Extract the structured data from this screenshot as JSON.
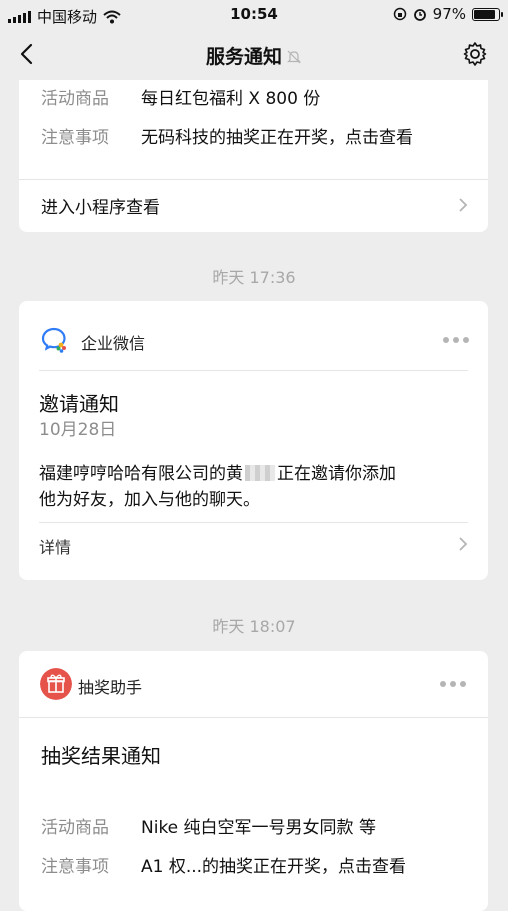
{
  "status_bar": {
    "carrier": "中国移动",
    "time": "10:54",
    "battery": "97%",
    "battery_level": 0.97
  },
  "nav": {
    "title": "服务通知"
  },
  "card1": {
    "rows": [
      {
        "key": "活动商品",
        "value": "每日红包福利 X 800 份"
      },
      {
        "key": "注意事项",
        "value": "无码科技的抽奖正在开奖，点击查看"
      }
    ],
    "link": "进入小程序查看"
  },
  "time1": "昨天 17:36",
  "card2": {
    "app_name": "企业微信",
    "title": "邀请通知",
    "date": "10月28日",
    "body_line1_a": "福建哼哼哈哈有限公司的黄",
    "body_line1_b": "正在邀请你添加",
    "body_line2": "他为好友，加入与他的聊天。",
    "detail": "详情"
  },
  "time2": "昨天 18:07",
  "card3": {
    "app_name": "抽奖助手",
    "title": "抽奖结果通知",
    "rows": [
      {
        "key": "活动商品",
        "value": "Nike  纯白空军一号男女同款 等"
      },
      {
        "key": "注意事项",
        "value": "A1  权...的抽奖正在开奖，点击查看"
      }
    ]
  },
  "colors": {
    "background": "#ededed",
    "card": "#ffffff",
    "muted": "#8d8d8d",
    "accent_red": "#e5534b",
    "wecom_blue": "#2f7cf6"
  }
}
